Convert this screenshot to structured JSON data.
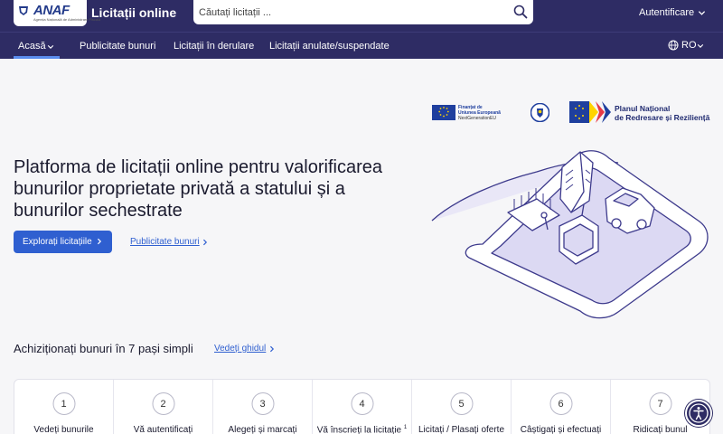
{
  "header": {
    "logo": "ANAF",
    "logo_tagline": "Agenția Națională de Administrare Fiscală",
    "app_title": "Licitații online",
    "search_placeholder": "Căutați licitații ...",
    "auth_label": "Autentificare"
  },
  "nav": {
    "items": [
      {
        "label": "Acasă",
        "active": true
      },
      {
        "label": "Publicitate bunuri"
      },
      {
        "label": "Licitații în derulare"
      },
      {
        "label": "Licitații anulate/suspendate"
      }
    ],
    "language": "RO"
  },
  "funding": {
    "eu_line1": "Finanțat de",
    "eu_line2": "Uniunea Europeană",
    "eu_line3": "NextGenerationEU",
    "pnrr_line1": "Planul Național",
    "pnrr_line2": "de Redresare și Reziliență"
  },
  "hero": {
    "title": "Platforma de licitații online pentru valorificarea bunurilor proprietate privată a statului și a bunurilor sechestrate",
    "primary_button": "Explorați licitațiile",
    "secondary_link": "Publicitate bunuri"
  },
  "steps_section": {
    "title": "Achiziționați bunuri în 7 pași simpli",
    "guide_link": "Vedeți ghidul",
    "steps": [
      {
        "num": "1",
        "label": "Vedeți bunurile"
      },
      {
        "num": "2",
        "label": "Vă autentificați"
      },
      {
        "num": "3",
        "label": "Alegeți și marcați"
      },
      {
        "num": "4",
        "label": "Vă înscrieți la licitație",
        "sup": "1"
      },
      {
        "num": "5",
        "label": "Licitați / Plasați oferte"
      },
      {
        "num": "6",
        "label": "Câștigați și efectuați"
      },
      {
        "num": "7",
        "label": "Ridicați bunul"
      }
    ]
  },
  "colors": {
    "header_bg": "#2e2c64",
    "primary": "#2f5fd0",
    "page_bg": "#f6f6f8"
  },
  "icons": [
    "search-icon",
    "chevron-down-icon",
    "chevron-right-icon",
    "globe-icon",
    "accessibility-icon"
  ]
}
